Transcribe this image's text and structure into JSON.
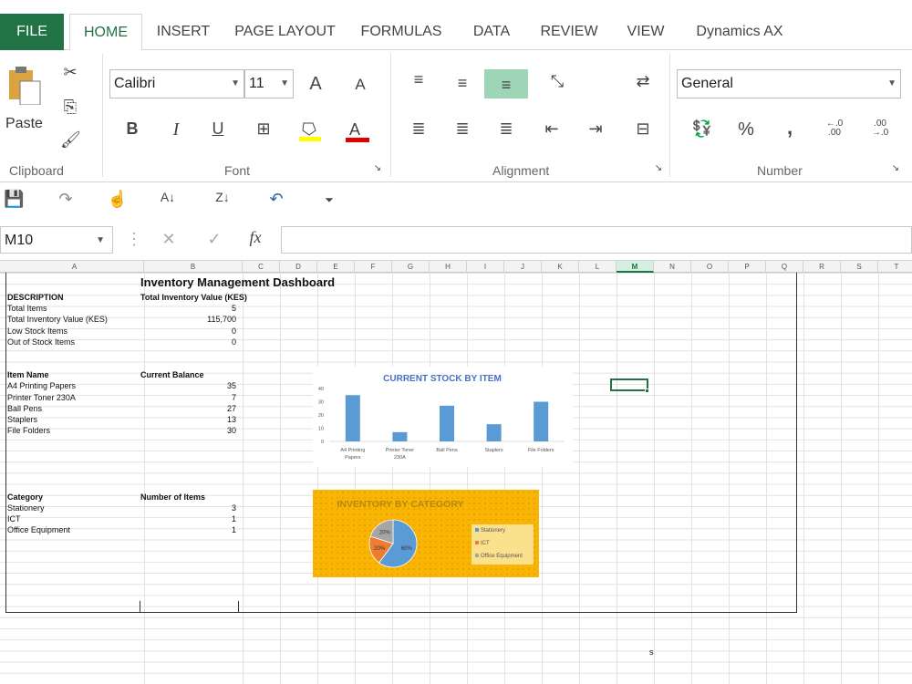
{
  "tabs": [
    "FILE",
    "HOME",
    "INSERT",
    "PAGE LAYOUT",
    "FORMULAS",
    "DATA",
    "REVIEW",
    "VIEW",
    "Dynamics AX"
  ],
  "ribbon": {
    "paste_label": "Paste",
    "font_name": "Calibri",
    "font_size": "11",
    "number_format": "General",
    "groups": [
      "Clipboard",
      "Font",
      "Alignment",
      "Number"
    ],
    "bold": "B",
    "italic": "I",
    "underline": "U",
    "percent": "%",
    "comma": ",",
    "inc_dec": "←.0\n.00",
    "dec_dec": ".00\n→.0"
  },
  "formula_bar": {
    "name_box": "M10",
    "fx": "fx",
    "formula": ""
  },
  "columns": [
    "A",
    "B",
    "C",
    "D",
    "E",
    "F",
    "G",
    "H",
    "I",
    "J",
    "K",
    "L",
    "M",
    "N",
    "O",
    "P",
    "Q",
    "R",
    "S",
    "T"
  ],
  "selected_column": "M",
  "sheet": {
    "title": "Inventory Management Dashboard",
    "summary_header": [
      "DESCRIPTION",
      "Total Inventory Value (KES)"
    ],
    "summary": [
      [
        "Total Items",
        "5"
      ],
      [
        "Total Inventory Value (KES)",
        "115,700"
      ],
      [
        "Low Stock Items",
        "0"
      ],
      [
        "Out of Stock Items",
        "0"
      ]
    ],
    "items_header": [
      "Item Name",
      "Current Balance"
    ],
    "items": [
      [
        "A4 Printing Papers",
        "35"
      ],
      [
        "Printer Toner 230A",
        "7"
      ],
      [
        "Ball Pens",
        "27"
      ],
      [
        "Staplers",
        "13"
      ],
      [
        "File Folders",
        "30"
      ]
    ],
    "category_header": [
      "Category",
      "Number of Items"
    ],
    "categories": [
      [
        "Stationery",
        "3"
      ],
      [
        "ICT",
        "1"
      ],
      [
        "Office Equipment",
        "1"
      ]
    ],
    "stray_cell": "s"
  },
  "chart_data": [
    {
      "type": "bar",
      "title": "CURRENT STOCK BY ITEM",
      "categories": [
        "A4 Printing Papers",
        "Printer Toner 230A",
        "Ball Pens",
        "Staplers",
        "File Folders"
      ],
      "values": [
        35,
        7,
        27,
        13,
        30
      ],
      "ylim": [
        0,
        40
      ],
      "yticks": [
        "0",
        "10",
        "20",
        "30",
        "40"
      ],
      "grid": false,
      "color": "#5b9bd5"
    },
    {
      "type": "pie",
      "title": "INVENTORY BY CATEGORY",
      "categories": [
        "Stationery",
        "ICT",
        "Office Equipment"
      ],
      "values": [
        60,
        20,
        20
      ],
      "labels": [
        "60%",
        "20%",
        "20%"
      ],
      "colors": [
        "#5b9bd5",
        "#ed7d31",
        "#a5a5a5"
      ],
      "legend": "right"
    }
  ],
  "colors": {
    "accent": "#217346",
    "selection": "#217346",
    "chart2_bg": "#f8b504"
  }
}
